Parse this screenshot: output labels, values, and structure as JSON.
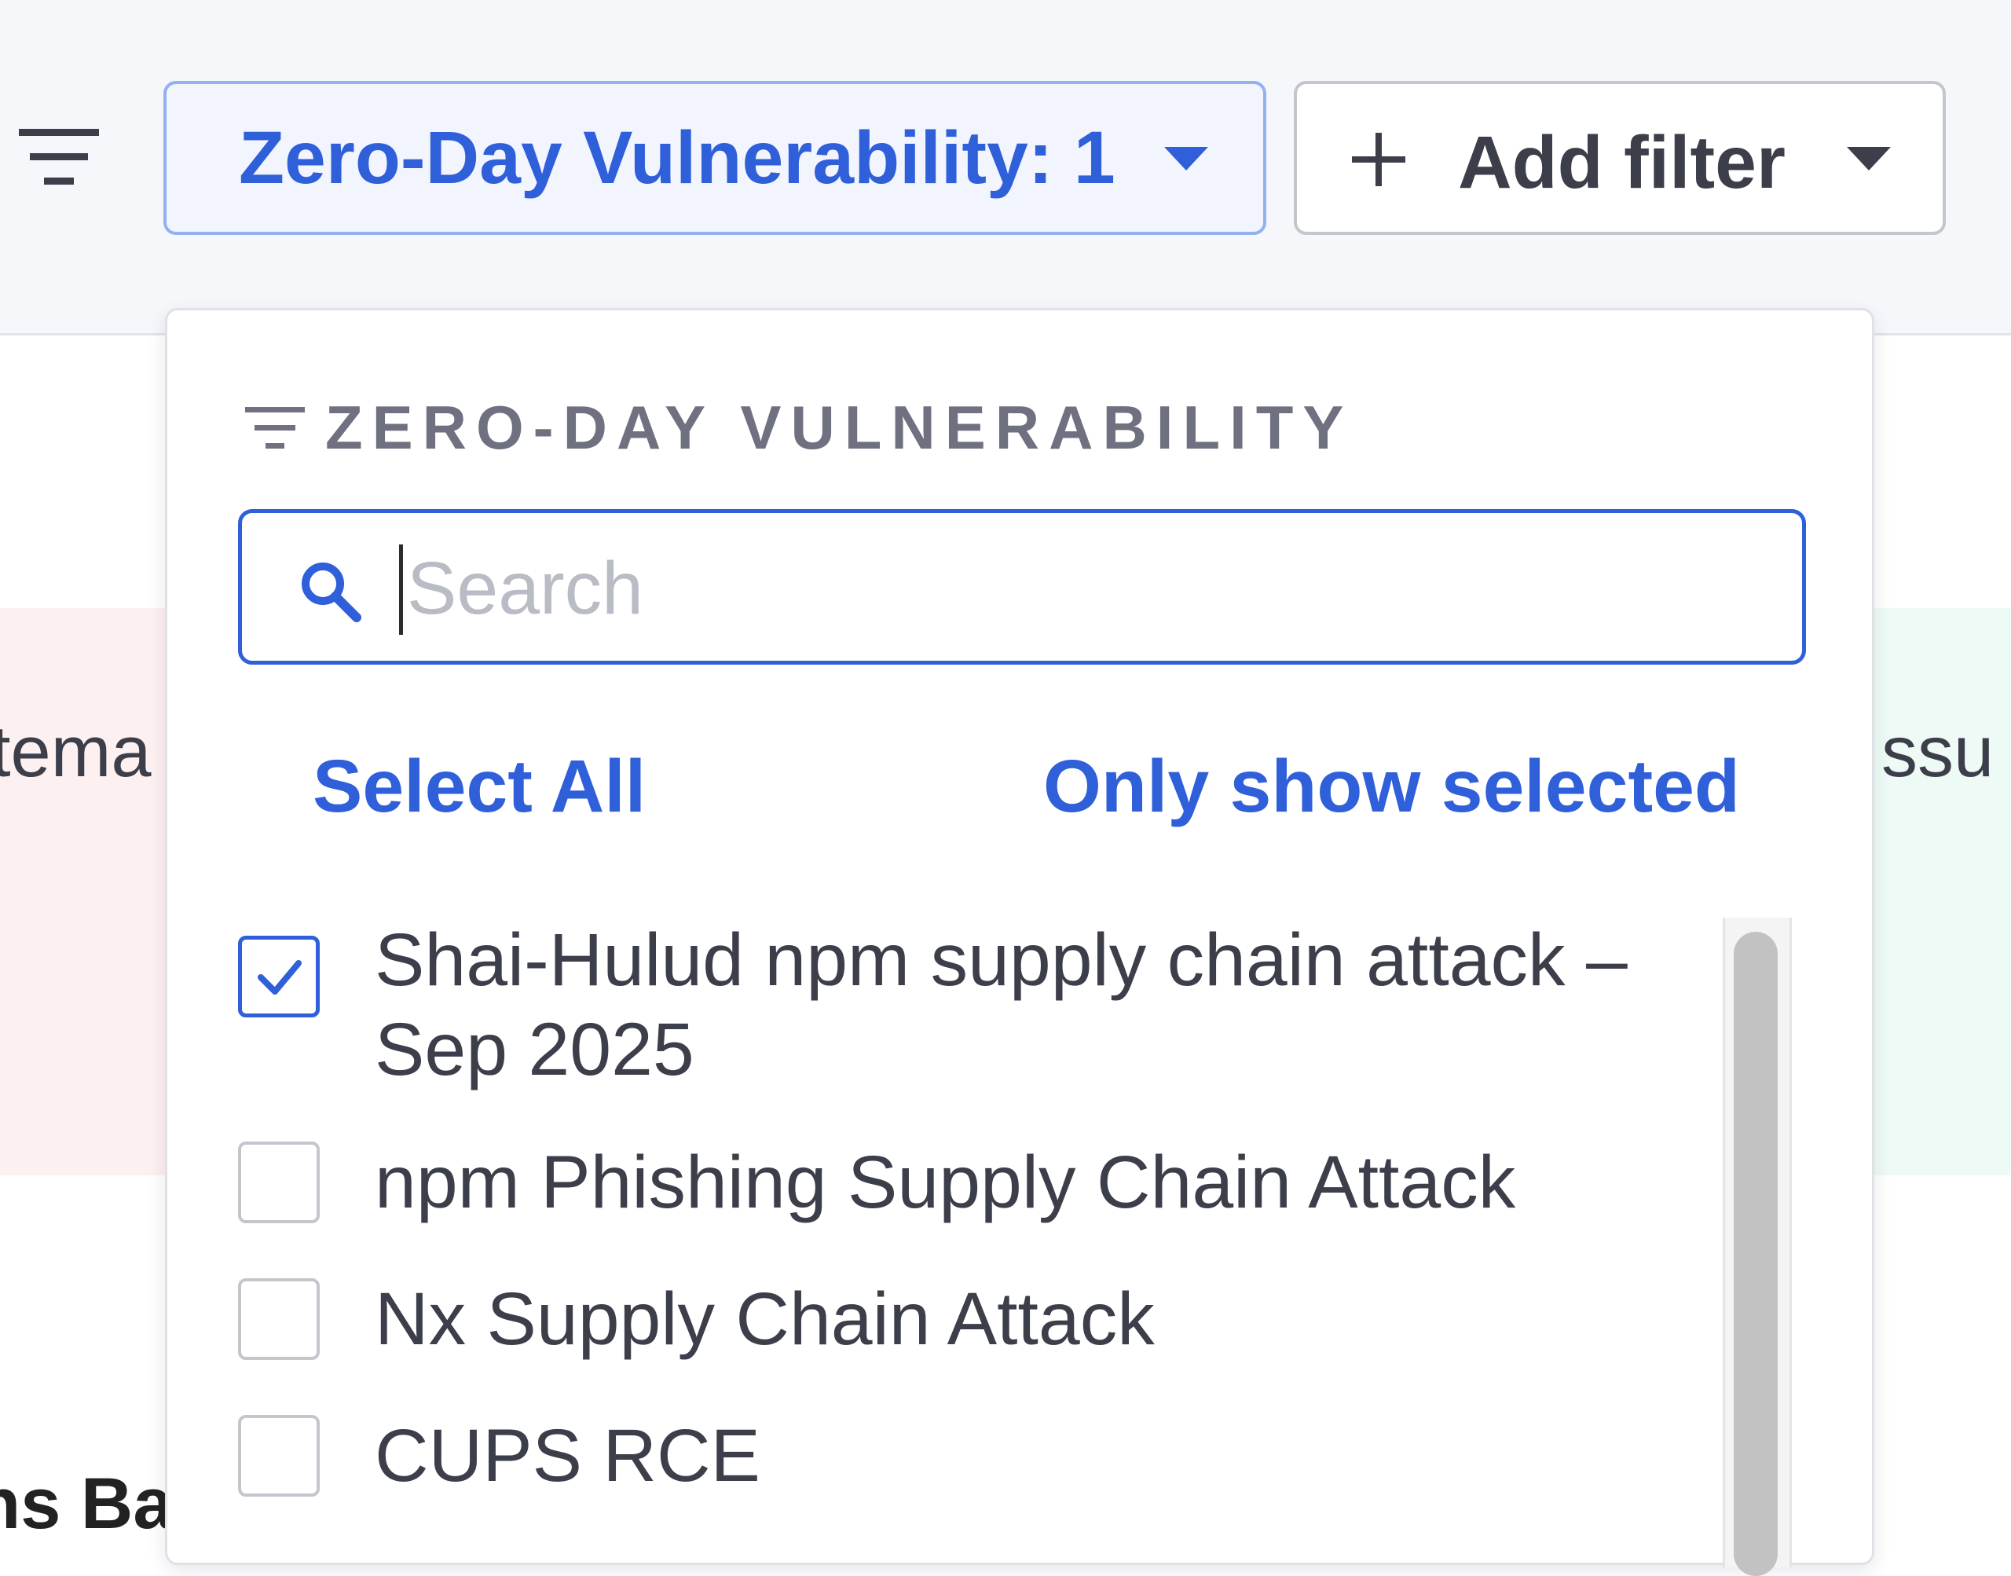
{
  "toolbar": {
    "active_filter_label": "Zero-Day Vulnerability: 1",
    "add_filter_label": "Add filter"
  },
  "background": {
    "left_fragment": "tema",
    "right_fragment": "ssu",
    "bottom_fragment": "ns Ba"
  },
  "dropdown": {
    "title": "ZERO-DAY VULNERABILITY",
    "search": {
      "placeholder": "Search",
      "value": ""
    },
    "select_all_label": "Select All",
    "only_show_selected_label": "Only show selected",
    "options": [
      {
        "label": "Shai-Hulud npm supply chain attack – Sep 2025",
        "checked": true
      },
      {
        "label": "npm Phishing Supply Chain Attack",
        "checked": false
      },
      {
        "label": "Nx Supply Chain Attack",
        "checked": false
      },
      {
        "label": "CUPS RCE",
        "checked": false
      }
    ]
  },
  "colors": {
    "accent": "#2f5fd9",
    "chip_active_bg": "#f2f5fe",
    "toolbar_bg": "#f6f7fb",
    "muted_text": "#6f7080"
  },
  "icons": [
    "filter-lines-icon",
    "chevron-down-icon",
    "plus-icon",
    "search-icon",
    "checkmark-icon"
  ]
}
